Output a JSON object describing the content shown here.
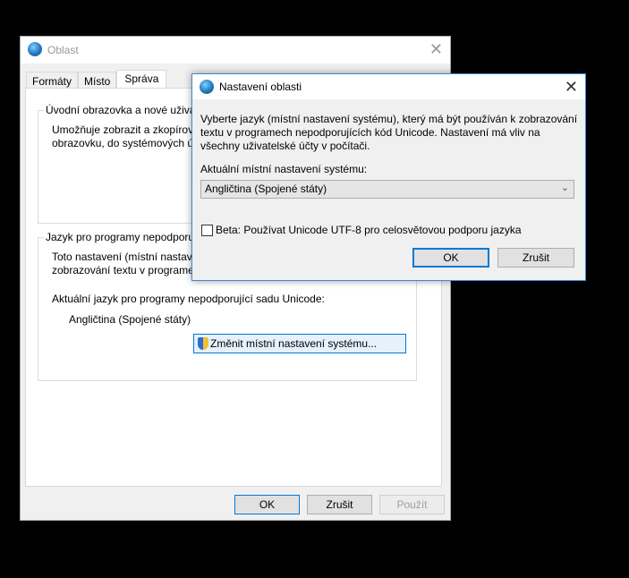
{
  "main_window": {
    "title": "Oblast",
    "tabs": [
      "Formáty",
      "Místo",
      "Správa"
    ],
    "group1": {
      "legend": "Úvodní obrazovka a nové uživat",
      "text": "Umožňuje zobrazit a zkopírova\nobrazovku, do systémových ú"
    },
    "group2": {
      "legend": "Jazyk pro programy nepodporu",
      "text": "Toto nastavení (místní nastave\nzobrazování textu v programe",
      "current_label": "Aktuální jazyk pro programy nepodporující sadu Unicode:",
      "current_value": "Angličtina (Spojené státy)",
      "change_button": "Změnit místní nastavení systému..."
    },
    "buttons": {
      "ok": "OK",
      "cancel": "Zrušit",
      "apply": "Použít"
    }
  },
  "dialog": {
    "title": "Nastavení oblasti",
    "description": "Vyberte jazyk (místní nastavení systému), který má být používán k zobrazování\ntextu v programech nepodporujících kód Unicode. Nastavení má vliv na\nvšechny uživatelské účty v počítači.",
    "locale_label": "Aktuální místní nastavení systému:",
    "locale_value": "Angličtina (Spojené státy)",
    "beta_checkbox": {
      "label": "Beta: Používat Unicode UTF-8 pro celosvětovou podporu jazyka",
      "checked": false
    },
    "buttons": {
      "ok": "OK",
      "cancel": "Zrušit"
    }
  }
}
